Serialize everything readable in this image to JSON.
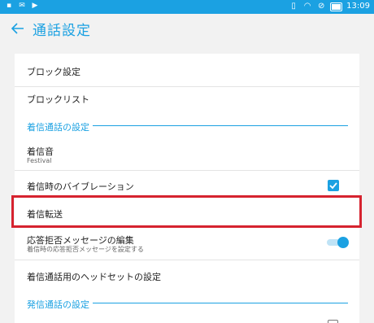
{
  "statusbar": {
    "time": "13:09",
    "left_icons": [
      "image-icon",
      "message-icon",
      "play-icon"
    ],
    "right_icons": [
      "vibrate-icon",
      "wifi-icon",
      "no-sim-icon",
      "battery-icon"
    ]
  },
  "appbar": {
    "title": "通話設定",
    "back_icon": "arrow-left-icon"
  },
  "items": {
    "block_settings": "ブロック設定",
    "block_list": "ブロックリスト",
    "incoming_section": "着信通話の設定",
    "ringtone": "着信音",
    "ringtone_value": "Festival",
    "vibrate_label": "着信時のバイブレーション",
    "vibrate_checked": true,
    "forwarding": "着信転送",
    "reject_msg_title": "応答拒否メッセージの編集",
    "reject_msg_sub": "着信時の応答拒否メッセージを設定する",
    "reject_msg_enabled": true,
    "headset": "着信通話用のヘッドセットの設定",
    "outgoing_section": "発信通話の設定"
  },
  "colors": {
    "accent": "#1ba1e2",
    "highlight_box": "#d6232f",
    "background": "#f2f2f2",
    "panel": "#ffffff"
  }
}
